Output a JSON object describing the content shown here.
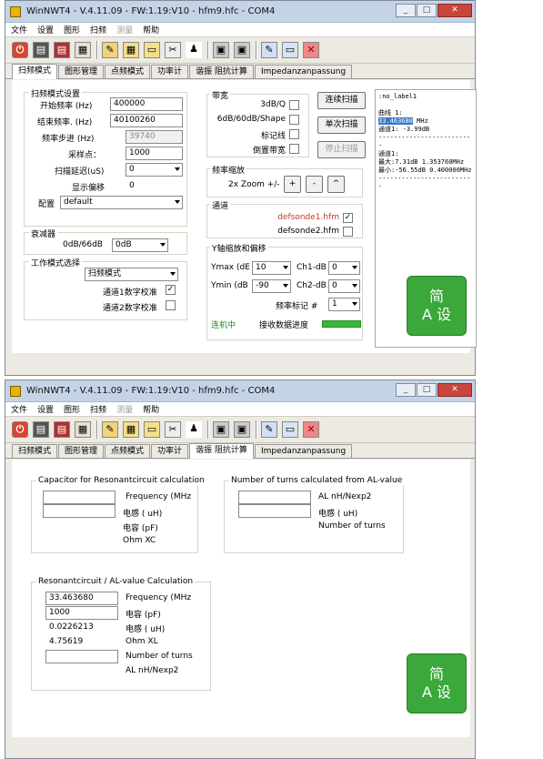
{
  "window1": {
    "title": "WinNWT4 - V.4.11.09 - FW:1.19:V10 - hfm9.hfc - COM4",
    "menu": [
      "文件",
      "设置",
      "图形",
      "扫频",
      "测量",
      "帮助"
    ],
    "tabs": [
      "扫频模式",
      "图形管理",
      "点频模式",
      "功率计",
      "谐振 阻抗计算",
      "Impedanzanpassung"
    ],
    "active_tab": "扫频模式",
    "sweep_settings": {
      "group_label": "扫频模式设置",
      "start_freq_label": "开始频率 (Hz)",
      "start_freq_value": "400000",
      "end_freq_label": "结束频率. (Hz)",
      "end_freq_value": "40100260",
      "step_label": "频率步进 (Hz)",
      "step_value": "39740",
      "samples_label": "采样点：",
      "samples_value": "1000",
      "delay_label": "扫描延迟(uS)",
      "delay_value": "0",
      "display_offset_label": "显示偏移",
      "display_offset_value": "0",
      "config_label": "配置",
      "config_value": "default"
    },
    "attenuator": {
      "group_label": "衰减器",
      "label": "0dB/66dB",
      "value": "0dB"
    },
    "work_mode": {
      "group_label": "工作模式选择",
      "value": "扫频模式",
      "ch1_label": "通道1数字校准",
      "ch2_label": "通道2数字校准"
    },
    "bandwidth": {
      "group_label": "带宽",
      "opt1": "3dB/Q",
      "opt2": "6dB/60dB/Shape",
      "opt3": "标记线",
      "opt4": "倒置带宽"
    },
    "buttons": {
      "continuous": "连续扫描",
      "single": "单次扫描",
      "stop": "停止扫描"
    },
    "freq_zoom": {
      "group_label": "频率缩放",
      "label": "2x Zoom +/-",
      "plus": "+",
      "minus": "-",
      "caret": "^"
    },
    "channel": {
      "group_label": "通道",
      "file1": "defsonde1.hfm",
      "file2": "defsonde2.hfm"
    },
    "y_axis": {
      "group_label": "Y轴缩放和偏移",
      "ymax_label": "Ymax (dE",
      "ymax_value": "10",
      "ymin_label": "Ymin (dB",
      "ymin_value": "-90",
      "ch1_label": "Ch1-dB",
      "ch1_value": "0",
      "ch2_label": "Ch2-dB",
      "ch2_value": "0",
      "marker_label": "频率标记 #",
      "marker_value": "1"
    },
    "status": {
      "connected": "连机中",
      "receiving": "接收数据进度"
    },
    "log": {
      "line1": ":no_label1",
      "line2": "曲线 1:",
      "line3_hl": "33.463680",
      "line3_rest": " MHz",
      "line4": "通道1: -3.99dB",
      "line5": "-------------------------",
      "line6": "通道1:",
      "line7": "最大:7.31dB 1.353760MHz",
      "line8": "最小:-56.55dB 0.400000MHz",
      "line9": "-------------------------"
    },
    "green_icon": {
      "line1": "简",
      "line2": "A 设"
    }
  },
  "window2": {
    "title": "WinNWT4 - V.4.11.09 - FW:1.19:V10 - hfm9.hfc - COM4",
    "menu": [
      "文件",
      "设置",
      "图形",
      "扫频",
      "测量",
      "帮助"
    ],
    "tabs": [
      "扫频模式",
      "图形管理",
      "点频模式",
      "功率计",
      "谐振 阻抗计算",
      "Impedanzanpassung"
    ],
    "active_tab": "谐振 阻抗计算",
    "capacitor_calc": {
      "group_label": "Capacitor for Resonantcircuit calculation",
      "freq_label": "Frequency (MHz",
      "ind_label": "电感 ( uH)",
      "cap_label": "电容 (pF)",
      "ohm_label": "Ohm XC"
    },
    "turns_calc": {
      "group_label": "Number of turns calculated from AL-value",
      "al_label": "AL nH/Nexp2",
      "ind_label": "电感 ( uH)",
      "turns_label": "Number of turns"
    },
    "resonant_calc": {
      "group_label": "Resonantcircuit / AL-value Calculation",
      "freq_value": "33.463680",
      "freq_label": "Frequency (MHz",
      "cap_value": "1000",
      "cap_label": "电容 (pF)",
      "ind_value": "0.0226213",
      "ind_label": "电感 ( uH)",
      "ohm_value": "4.75619",
      "ohm_label": "Ohm XL",
      "turns_label": "Number of turns",
      "al_label": "AL nH/Nexp2"
    },
    "green_icon": {
      "line1": "简",
      "line2": "A 设"
    }
  },
  "colors": {
    "accent_green": "#38b838",
    "title_bg": "#c5d3e6",
    "close_red": "#c9463d",
    "channel_red": "#c0392b"
  }
}
